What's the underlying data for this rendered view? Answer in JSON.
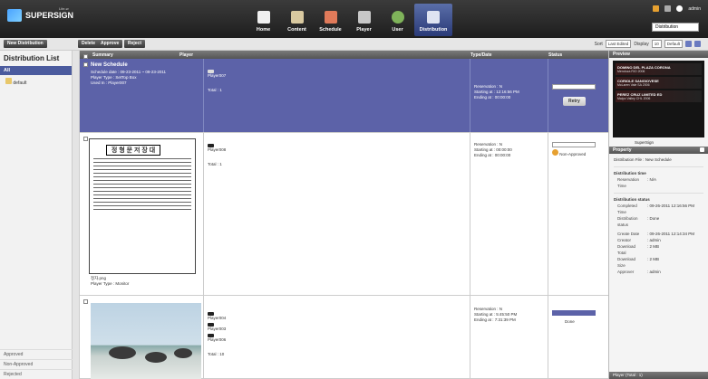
{
  "app": {
    "logo": "SUPERSIGN",
    "logo_sub": "Lite-w"
  },
  "nav": [
    {
      "label": "Home"
    },
    {
      "label": "Content"
    },
    {
      "label": "Schedule"
    },
    {
      "label": "Player"
    },
    {
      "label": "User"
    },
    {
      "label": "Distribution",
      "active": true
    }
  ],
  "topright": {
    "user": "admin",
    "dist_select": "Distribution"
  },
  "toolbar": {
    "new_distribution": "New Distribution",
    "delete": "Delete",
    "approve": "Approve",
    "reject": "Reject",
    "sort_label": "Sort",
    "sort_value": "Last Edited",
    "display_label": "Display",
    "display_value": "10",
    "view_value": "Default"
  },
  "left": {
    "title": "Distribution List",
    "all": "All",
    "tree_item": "default",
    "footer": [
      "Approved",
      "Non-Approved",
      "Rejected"
    ]
  },
  "columns": {
    "summary": "Summary",
    "player": "Player",
    "type": "Type/Date",
    "status": "Status"
  },
  "rows": [
    {
      "title": "New Schedule",
      "line1": "Schedule date : 09-23-2011 ~ 09-23-2011",
      "line2": "Player Type : SetTop Box",
      "line3": "Used In : Player007",
      "players": [
        "Player007"
      ],
      "total": "Total : 1",
      "type_lines": [
        "Reservation : N",
        "Starting at   : 12:16:56 PM",
        "Ending at      : 00:00:00"
      ],
      "status_btn": "Retry"
    },
    {
      "doc_title": "정 형 문 저 장 대",
      "caption1": "정자.png",
      "caption2": "Player Type : Monitor",
      "players": [
        "Player008"
      ],
      "total": "Total : 1",
      "type_lines": [
        "Reservation : N",
        "Starting at   : 00:00:00",
        "Ending at      : 00:00:00"
      ],
      "status": "Non-Approved"
    },
    {
      "players": [
        "Player004",
        "Player003",
        "Player006"
      ],
      "total": "Total : 10",
      "type_lines": [
        "Reservation : N",
        "Starting at   : 5:45:50 PM",
        "Ending at      : 7:31:39 PM"
      ],
      "status": "Done"
    }
  ],
  "right": {
    "preview_title": "Preview",
    "preview_blocks": [
      {
        "h": "DOMINO DEL PLAZA CORONA",
        "s": "Mendoza RIO 2006"
      },
      {
        "h": "CORIOLE SANGIOVESE",
        "s": "McLaren Vale SA 2006"
      },
      {
        "h": "PEREZ CRUZ LIMITED ED",
        "s": "Maipo Valley CHL 2006"
      }
    ],
    "preview_caption": "SuperSign",
    "property_title": "Property",
    "dist_file": "Distribution File : New Schedule",
    "sec_time": "Distribution time",
    "reservation_k": "Reservation Time",
    "reservation_v": ": N/A",
    "sec_status": "Distribution status",
    "completed_k": "Completed Time",
    "completed_v": ": 09-26-2011 12:16:56 PM",
    "dstatus_k": "Distribution status",
    "dstatus_v": ": Done",
    "create_k": "Create Date",
    "create_v": ": 09-26-2011 12:14:34 PM",
    "creator_k": "Creator",
    "creator_v": ": admin",
    "dtotal_k": "Download Total",
    "dtotal_v": ": 2 MB",
    "dsize_k": "Download Size",
    "dsize_v": ": 2 MB",
    "approver_k": "Approver",
    "approver_v": ": admin",
    "players_title": "Player (Total : 1)"
  }
}
